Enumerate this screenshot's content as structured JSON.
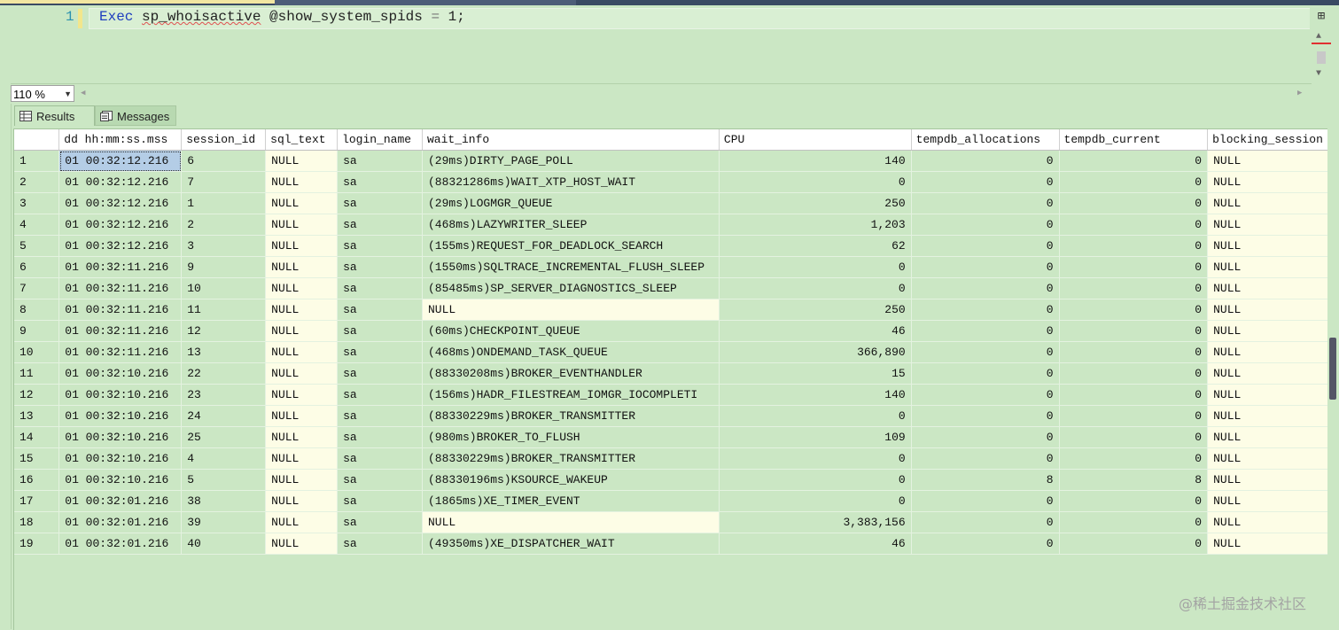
{
  "editor": {
    "line_number": "1",
    "keyword": "Exec",
    "proc_name": "sp_whoisactive",
    "param": " @show_system_spids ",
    "op": "=",
    "value": " 1;"
  },
  "zoom": {
    "value": "110 %"
  },
  "tabs": {
    "results": "Results",
    "messages": "Messages"
  },
  "columns": [
    "",
    "dd hh:mm:ss.mss",
    "session_id",
    "sql_text",
    "login_name",
    "wait_info",
    "CPU",
    "tempdb_allocations",
    "tempdb_current",
    "blocking_session"
  ],
  "rows": [
    [
      "1",
      "01 00:32:12.216",
      "6",
      "NULL",
      "sa",
      "(29ms)DIRTY_PAGE_POLL",
      "140",
      "0",
      "0",
      "NULL"
    ],
    [
      "2",
      "01 00:32:12.216",
      "7",
      "NULL",
      "sa",
      "(88321286ms)WAIT_XTP_HOST_WAIT",
      "0",
      "0",
      "0",
      "NULL"
    ],
    [
      "3",
      "01 00:32:12.216",
      "1",
      "NULL",
      "sa",
      "(29ms)LOGMGR_QUEUE",
      "250",
      "0",
      "0",
      "NULL"
    ],
    [
      "4",
      "01 00:32:12.216",
      "2",
      "NULL",
      "sa",
      "(468ms)LAZYWRITER_SLEEP",
      "1,203",
      "0",
      "0",
      "NULL"
    ],
    [
      "5",
      "01 00:32:12.216",
      "3",
      "NULL",
      "sa",
      "(155ms)REQUEST_FOR_DEADLOCK_SEARCH",
      "62",
      "0",
      "0",
      "NULL"
    ],
    [
      "6",
      "01 00:32:11.216",
      "9",
      "NULL",
      "sa",
      "(1550ms)SQLTRACE_INCREMENTAL_FLUSH_SLEEP",
      "0",
      "0",
      "0",
      "NULL"
    ],
    [
      "7",
      "01 00:32:11.216",
      "10",
      "NULL",
      "sa",
      "(85485ms)SP_SERVER_DIAGNOSTICS_SLEEP",
      "0",
      "0",
      "0",
      "NULL"
    ],
    [
      "8",
      "01 00:32:11.216",
      "11",
      "NULL",
      "sa",
      "NULL",
      "250",
      "0",
      "0",
      "NULL"
    ],
    [
      "9",
      "01 00:32:11.216",
      "12",
      "NULL",
      "sa",
      "(60ms)CHECKPOINT_QUEUE",
      "46",
      "0",
      "0",
      "NULL"
    ],
    [
      "10",
      "01 00:32:11.216",
      "13",
      "NULL",
      "sa",
      "(468ms)ONDEMAND_TASK_QUEUE",
      "366,890",
      "0",
      "0",
      "NULL"
    ],
    [
      "11",
      "01 00:32:10.216",
      "22",
      "NULL",
      "sa",
      "(88330208ms)BROKER_EVENTHANDLER",
      "15",
      "0",
      "0",
      "NULL"
    ],
    [
      "12",
      "01 00:32:10.216",
      "23",
      "NULL",
      "sa",
      "(156ms)HADR_FILESTREAM_IOMGR_IOCOMPLETI",
      "140",
      "0",
      "0",
      "NULL"
    ],
    [
      "13",
      "01 00:32:10.216",
      "24",
      "NULL",
      "sa",
      "(88330229ms)BROKER_TRANSMITTER",
      "0",
      "0",
      "0",
      "NULL"
    ],
    [
      "14",
      "01 00:32:10.216",
      "25",
      "NULL",
      "sa",
      "(980ms)BROKER_TO_FLUSH",
      "109",
      "0",
      "0",
      "NULL"
    ],
    [
      "15",
      "01 00:32:10.216",
      "4",
      "NULL",
      "sa",
      "(88330229ms)BROKER_TRANSMITTER",
      "0",
      "0",
      "0",
      "NULL"
    ],
    [
      "16",
      "01 00:32:10.216",
      "5",
      "NULL",
      "sa",
      "(88330196ms)KSOURCE_WAKEUP",
      "0",
      "8",
      "8",
      "NULL"
    ],
    [
      "17",
      "01 00:32:01.216",
      "38",
      "NULL",
      "sa",
      "(1865ms)XE_TIMER_EVENT",
      "0",
      "0",
      "0",
      "NULL"
    ],
    [
      "18",
      "01 00:32:01.216",
      "39",
      "NULL",
      "sa",
      "NULL",
      "3,383,156",
      "0",
      "0",
      "NULL"
    ],
    [
      "19",
      "01 00:32:01.216",
      "40",
      "NULL",
      "sa",
      "(49350ms)XE_DISPATCHER_WAIT",
      "46",
      "0",
      "0",
      "NULL"
    ]
  ],
  "watermark": "@稀土掘金技术社区"
}
